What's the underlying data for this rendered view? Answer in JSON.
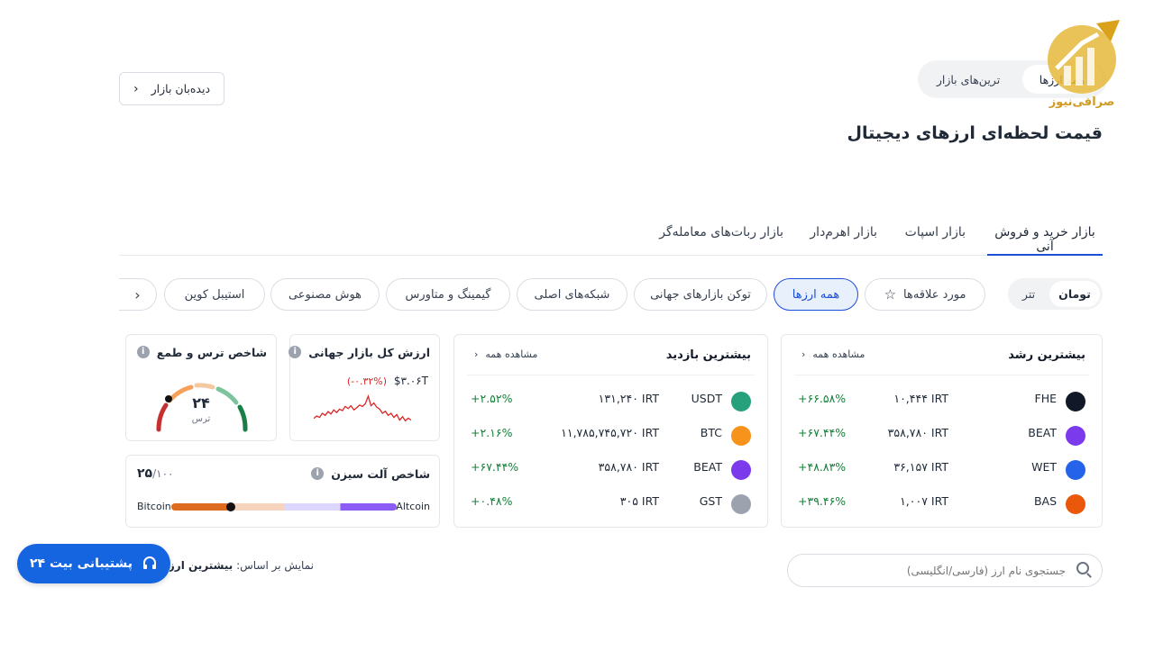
{
  "market_watch_btn": "دیده‌بان بازار",
  "top_toggle": {
    "all": "همه ارزها",
    "top": "ترین‌های بازار"
  },
  "logo_text": "صرافی‌نیوز",
  "page_title": "قیمت لحظه‌ای ارزهای دیجیتال",
  "tabs": [
    "بازار خرید و فروش آنی",
    "بازار اسپات",
    "بازار اهرم‌دار",
    "بازار ربات‌های معامله‌گر"
  ],
  "currency_toggle": {
    "toman": "تومان",
    "tether": "تتر"
  },
  "categories": {
    "favorites": "مورد علاقه‌ها",
    "all": "همه ارزها",
    "global": "توکن بازارهای جهانی",
    "networks": "شبکه‌های اصلی",
    "gaming": "گیمینگ و متاورس",
    "ai": "هوش مصنوعی",
    "stable": "استیبل کوین"
  },
  "growth": {
    "title": "بیشترین رشد",
    "see_all": "مشاهده همه",
    "rows": [
      {
        "sym": "FHE",
        "price": "۱۰,۴۴۴ IRT",
        "pct": "+۶۶.۵۸%",
        "color": "#111827"
      },
      {
        "sym": "BEAT",
        "price": "۳۵۸,۷۸۰ IRT",
        "pct": "+۶۷.۴۴%",
        "color": "#7c3aed"
      },
      {
        "sym": "WET",
        "price": "۳۶,۱۵۷ IRT",
        "pct": "+۴۸.۸۳%",
        "color": "#2563eb"
      },
      {
        "sym": "BAS",
        "price": "۱,۰۰۷ IRT",
        "pct": "+۳۹.۴۶%",
        "color": "#ea580c"
      }
    ]
  },
  "visited": {
    "title": "بیشترین بازدید",
    "see_all": "مشاهده همه",
    "rows": [
      {
        "sym": "USDT",
        "price": "۱۳۱,۲۴۰ IRT",
        "pct": "+۲.۵۲%",
        "color": "#26a17b"
      },
      {
        "sym": "BTC",
        "price": "۱۱,۷۸۵,۷۴۵,۷۲۰ IRT",
        "pct": "+۲.۱۶%",
        "color": "#f7931a"
      },
      {
        "sym": "BEAT",
        "price": "۳۵۸,۷۸۰ IRT",
        "pct": "+۶۷.۴۴%",
        "color": "#7c3aed"
      },
      {
        "sym": "GST",
        "price": "۳۰۵ IRT",
        "pct": "+۰.۴۸%",
        "color": "#9ca3af"
      }
    ]
  },
  "global_cap": {
    "title": "ارزش کل بازار جهانی",
    "value": "$۳.۰۶T",
    "change": "(-۰.۳۲%)"
  },
  "fear_greed": {
    "title": "شاخص ترس و طمع",
    "value": "۲۴",
    "label": "ترس"
  },
  "altseason": {
    "title": "شاخص آلت سیزن",
    "value": "۲۵",
    "max": "/۱۰۰",
    "bitcoin": "Bitcoin",
    "altcoin": "Altcoin"
  },
  "support_btn": "پشتیبانی بیت ۲۴",
  "sort": {
    "label": "نمایش بر اساس:",
    "value": "بیشترین ارزش"
  },
  "search": {
    "placeholder": "جستجوی نام ارز (فارسی/انگلیسی)"
  },
  "sparkline": [
    0.35,
    0.42,
    0.38,
    0.5,
    0.44,
    0.55,
    0.48,
    0.6,
    0.52,
    0.62,
    0.58,
    0.7,
    0.64,
    0.72,
    0.6,
    0.66,
    0.74,
    0.7,
    0.78,
    1.0,
    0.72,
    0.8,
    0.68,
    0.62,
    0.5,
    0.56,
    0.44,
    0.5,
    0.38,
    0.46,
    0.3,
    0.4,
    0.28,
    0.36,
    0.3
  ]
}
